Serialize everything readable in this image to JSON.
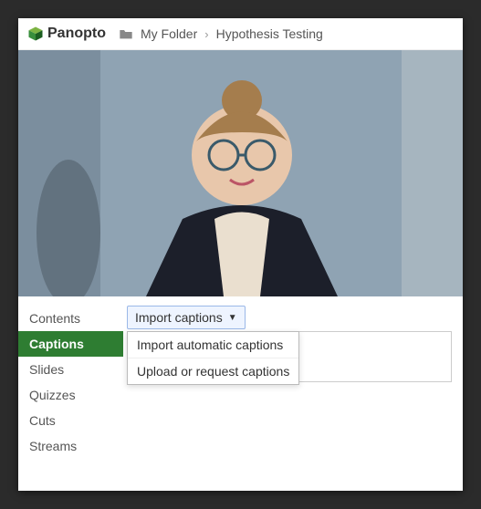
{
  "brand": {
    "name": "Panopto"
  },
  "breadcrumb": {
    "folder": "My Folder",
    "page": "Hypothesis Testing"
  },
  "sidebar": {
    "items": [
      {
        "label": "Contents",
        "active": false
      },
      {
        "label": "Captions",
        "active": true
      },
      {
        "label": "Slides",
        "active": false
      },
      {
        "label": "Quizzes",
        "active": false
      },
      {
        "label": "Cuts",
        "active": false
      },
      {
        "label": "Streams",
        "active": false
      }
    ]
  },
  "captions_panel": {
    "dropdown_label": "Import captions",
    "menu": [
      "Import automatic captions",
      "Upload or request captions"
    ]
  },
  "colors": {
    "active_tab": "#2e7d32"
  }
}
